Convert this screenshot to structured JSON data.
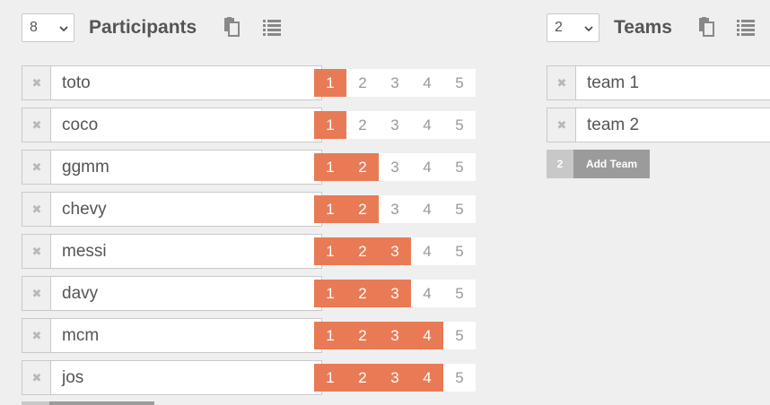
{
  "participants": {
    "count_select": "8",
    "title": "Participants",
    "rows": [
      {
        "name": "toto",
        "level": 1
      },
      {
        "name": "coco",
        "level": 1
      },
      {
        "name": "ggmm",
        "level": 2
      },
      {
        "name": "chevy",
        "level": 2
      },
      {
        "name": "messi",
        "level": 3
      },
      {
        "name": "davy",
        "level": 3
      },
      {
        "name": "mcm",
        "level": 4
      },
      {
        "name": "jos",
        "level": 4
      }
    ],
    "level_labels": [
      "1",
      "2",
      "3",
      "4",
      "5"
    ]
  },
  "teams": {
    "count_select": "2",
    "title": "Teams",
    "rows": [
      {
        "name": "team 1"
      },
      {
        "name": "team 2"
      }
    ],
    "add_count": "2",
    "add_label": "Add Team"
  },
  "icons": {
    "remove": "close-icon",
    "copy": "clipboard-icon",
    "list": "list-icon"
  },
  "colors": {
    "accent": "#e97a56",
    "background": "#efefef",
    "add_button": "#9b9b9b"
  }
}
